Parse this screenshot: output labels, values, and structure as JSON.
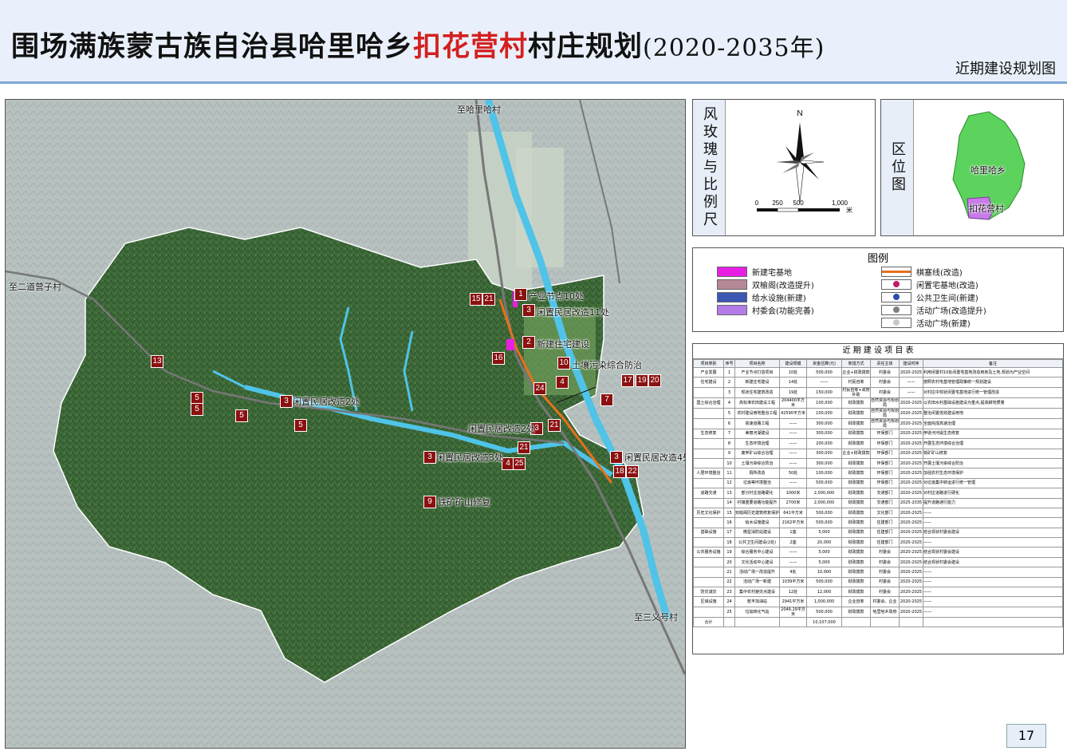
{
  "header": {
    "title_pre": "围场满族蒙古族自治县哈里哈乡",
    "title_highlight": "扣花营村",
    "title_post": "村庄规划",
    "title_year": "(2020-2035年)",
    "subtitle": "近期建设规划图"
  },
  "map": {
    "labels": {
      "north": "至哈里哈村",
      "west": "至二道营子村",
      "southeast": "至三义号村"
    },
    "markers": [
      {
        "n": "1"
      },
      {
        "n": "15"
      },
      {
        "n": "21"
      },
      {
        "n": "3"
      },
      {
        "n": "2"
      },
      {
        "n": "16"
      },
      {
        "n": "10"
      },
      {
        "n": "24"
      },
      {
        "n": "4"
      },
      {
        "n": "17"
      },
      {
        "n": "19"
      },
      {
        "n": "20"
      },
      {
        "n": "7"
      },
      {
        "n": "13"
      },
      {
        "n": "5"
      },
      {
        "n": "5"
      },
      {
        "n": "5"
      },
      {
        "n": "3"
      },
      {
        "n": "5"
      },
      {
        "n": "3"
      },
      {
        "n": "21"
      },
      {
        "n": "21"
      },
      {
        "n": "3"
      },
      {
        "n": "4"
      },
      {
        "n": "25"
      },
      {
        "n": "3"
      },
      {
        "n": "18"
      },
      {
        "n": "22"
      },
      {
        "n": "9"
      }
    ],
    "project_labels": [
      "产业节点10处",
      "闲置民居改造11处",
      "新建住宅建设",
      "土壤污染综合防治",
      "闲置民居改造2处",
      "闲置民居改造2处",
      "闲置民居改造3处",
      "闲置民居改造4处",
      "铁矿矿山修复"
    ]
  },
  "compass": {
    "title": "风玫瑰与比例尺",
    "north": "N",
    "scale_ticks": [
      "0",
      "250",
      "500",
      "1,000"
    ],
    "scale_unit": "米"
  },
  "location": {
    "title": "区位图",
    "township": "哈里哈乡",
    "village": "扣花营村"
  },
  "legend": {
    "title": "图例",
    "items": [
      {
        "label": "新建宅基地",
        "color": "#e61fe3"
      },
      {
        "label": "双榆阁(改造提升)",
        "color": "#b48895"
      },
      {
        "label": "给水设施(新建)",
        "color": "#3b57b3"
      },
      {
        "label": "村委会(功能完善)",
        "color": "#b47be8"
      },
      {
        "label": "棋塞线(改造)",
        "color": "#e8701c"
      },
      {
        "label": "闲置宅基地(改造)",
        "color": "#c01b6a"
      },
      {
        "label": "公共卫生间(新建)",
        "color": "#2a4fb0"
      },
      {
        "label": "活动广场(改造提升)",
        "color": "#808080"
      },
      {
        "label": "活动广场(新建)",
        "color": "#c8c8c8"
      }
    ]
  },
  "table": {
    "caption": "近 期 建 设 项 目 表",
    "headers": [
      "项目类别",
      "序号",
      "项目名称",
      "建设规模",
      "资金估算(元)",
      "筹措方式",
      "责任主体",
      "建设时序",
      "备注"
    ],
    "rows": [
      [
        "产业发展",
        "1",
        "产业节点打造项目",
        "10处",
        "500,000",
        "企业+财政拨款",
        "村委会",
        "2020-2025",
        "利用闲置村10处闲置宅基地改造用房及土地,规划为产业空间"
      ],
      [
        "住宅建设",
        "2",
        "新建住宅建设",
        "14处",
        "——",
        "村民自筹",
        "村委会",
        "——",
        "按照农村宅基地管理政策统一规划建设"
      ],
      [
        "",
        "3",
        "现状住宅建筑改造",
        "19处",
        "150,000",
        "村民自筹+政府补助",
        "村委会",
        "——",
        "对村庄中现状闲置宅基地进行统一管理改造"
      ],
      [
        "国土综合治理",
        "4",
        "高标准农田建设工程",
        "204400平方米",
        "100,000",
        "财政拨款",
        "自然资源与规划局",
        "2020-2025",
        "以农田水利基础设施建设为重点,提高耕地质量"
      ],
      [
        "",
        "5",
        "农村建设用地整治工程",
        "42590平方米",
        "100,000",
        "财政拨款",
        "自然资源与规划局",
        "2020-2025",
        "整治闲置低效建设用地"
      ],
      [
        "",
        "6",
        "高速道路工程",
        "——",
        "300,000",
        "财政拨款",
        "自然资源与规划局",
        "2020-2025",
        "全面完成高速治理"
      ],
      [
        "生态修复",
        "7",
        "美丽河湖建设",
        "——",
        "300,000",
        "财政拨款",
        "环保部门",
        "2020-2025",
        "伊逊河河堤生态修复"
      ],
      [
        "",
        "8",
        "生态环境治理",
        "——",
        "200,000",
        "财政拨款",
        "环保部门",
        "2020-2025",
        "开展生态环境综合治理"
      ],
      [
        "",
        "9",
        "废弃矿山综合治理",
        "——",
        "300,000",
        "企业+财政拨款",
        "环保部门",
        "2020-2025",
        "铁矿矿山修复"
      ],
      [
        "",
        "10",
        "土壤污染综合防治",
        "——",
        "300,000",
        "财政拨款",
        "环保部门",
        "2020-2025",
        "开展土壤污染综合防治"
      ],
      [
        "人居环境整治",
        "11",
        "厕所改造",
        "50处",
        "100,000",
        "财政拨款",
        "环保部门",
        "2020-2025",
        "加强农村生态环境保护"
      ],
      [
        "",
        "12",
        "垃圾等环境整治",
        "——",
        "500,000",
        "财政拨款",
        "环保部门",
        "2020-2025",
        "对垃圾集中转运进行统一管理"
      ],
      [
        "道路交通",
        "13",
        "部分村庄道路硬化",
        "1000米",
        "2,000,000",
        "财政拨款",
        "交通部门",
        "2020-2025",
        "对村庄道路进行硬化"
      ],
      [
        "",
        "14",
        "村镇重要道路功能提升",
        "2700米",
        "2,000,000",
        "财政拨款",
        "交通部门",
        "2025-2035",
        "提升道路通行能力"
      ],
      [
        "历史文化保护",
        "15",
        "双榆阁历史建筑修复保护",
        "641平方米",
        "500,000",
        "财政拨款",
        "文化部门",
        "2020-2025",
        "——"
      ],
      [
        "",
        "16",
        "给水设施建设",
        "2162平方米",
        "500,000",
        "财政拨款",
        "住建部门",
        "2020-2025",
        "——"
      ],
      [
        "基础设施",
        "17",
        "微型消防站建设",
        "1座",
        "5,000",
        "财政拨款",
        "住建部门",
        "2020-2025",
        "结合现状村委会建设"
      ],
      [
        "",
        "18",
        "公共卫生间建设(2处)",
        "2座",
        "20,000",
        "财政拨款",
        "住建部门",
        "2020-2025",
        "——"
      ],
      [
        "公共服务设施",
        "19",
        "综合服务中心建设",
        "——",
        "5,000",
        "财政拨款",
        "村委会",
        "2020-2025",
        "结合现状村委会建设"
      ],
      [
        "",
        "20",
        "文化活动中心建设",
        "——",
        "5,000",
        "财政拨款",
        "村委会",
        "2020-2025",
        "结合现状村委会建设"
      ],
      [
        "",
        "21",
        "活动广场一改造提升",
        "4处",
        "10,000",
        "财政拨款",
        "村委会",
        "2020-2025",
        "——"
      ],
      [
        "",
        "22",
        "活动广场一新建",
        "1039平方米",
        "500,000",
        "财政拨款",
        "村委会",
        "2020-2025",
        "——"
      ],
      [
        "防灾减灾",
        "23",
        "集中农村避灾点建设",
        "12处",
        "12,000",
        "财政拨款",
        "村委会",
        "2020-2025",
        "——"
      ],
      [
        "区域设施",
        "24",
        "乾丰加油站",
        "2941平方米",
        "1,000,000",
        "企业自筹",
        "村委会、企业",
        "2020-2025",
        "——"
      ],
      [
        "",
        "25",
        "垃圾转化气站",
        "2046.29平方米",
        "500,000",
        "财政拨款",
        "哈里哈乡政府",
        "2020-2025",
        "——"
      ],
      [
        "合计",
        "",
        "",
        "",
        "10,107,000",
        "",
        "",
        "",
        ""
      ]
    ]
  },
  "page_number": "17"
}
